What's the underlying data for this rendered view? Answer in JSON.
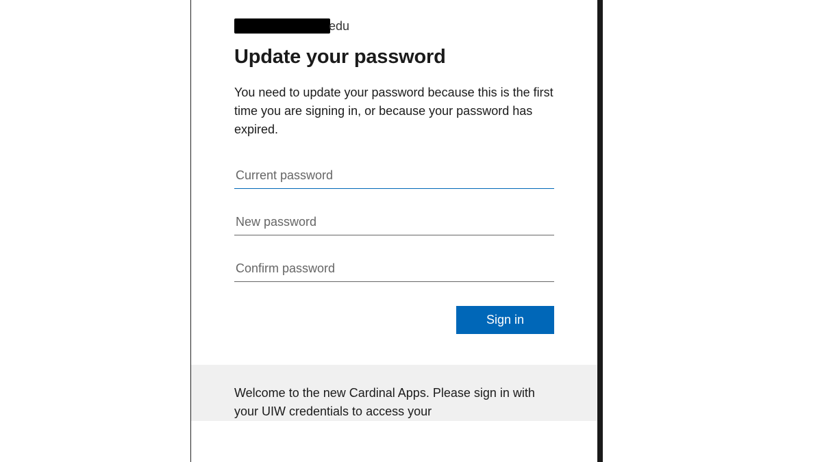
{
  "account": {
    "suffix": "edu"
  },
  "heading": "Update your password",
  "description": "You need to update your password because this is the first time you are signing in, or because your password has expired.",
  "fields": {
    "current_placeholder": "Current password",
    "new_placeholder": "New password",
    "confirm_placeholder": "Confirm password"
  },
  "button": {
    "signin_label": "Sign in"
  },
  "footer": {
    "welcome_text": "Welcome to the new Cardinal Apps. Please sign in with your UIW credentials to access your"
  }
}
